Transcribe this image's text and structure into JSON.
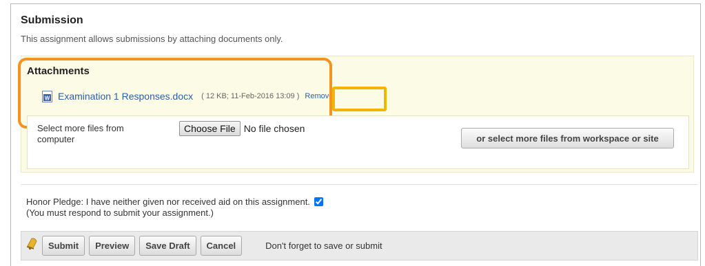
{
  "submission": {
    "title": "Submission",
    "subtitle": "This assignment allows submissions by attaching documents only."
  },
  "attachments": {
    "heading": "Attachments",
    "files": [
      {
        "icon": "word-document-icon",
        "name": "Examination 1 Responses.docx",
        "meta": "( 12 KB; 11-Feb-2016 13:09 )",
        "remove_label": "Remove"
      }
    ],
    "select_label": "Select more files from computer",
    "choose_file_label": "Choose File",
    "no_file_text": "No file chosen",
    "workspace_button": "or select more files from workspace or site"
  },
  "honor": {
    "pledge": "Honor Pledge: I have neither given nor received aid on this assignment.",
    "note": "(You must respond to submit your assignment.)",
    "checked": true
  },
  "actions": {
    "submit": "Submit",
    "preview": "Preview",
    "save_draft": "Save Draft",
    "cancel": "Cancel",
    "reminder": "Don't forget to save or submit"
  },
  "colors": {
    "highlight_orange": "#f39321",
    "highlight_yellow": "#f5b400",
    "link": "#2b5fa8",
    "panel_bg": "#fcfbe6"
  }
}
